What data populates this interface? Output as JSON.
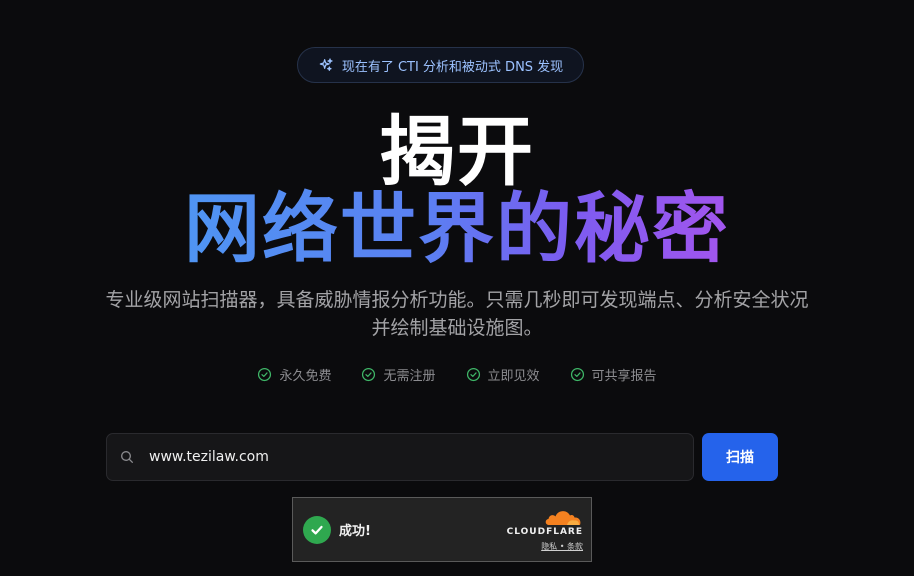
{
  "announcement": {
    "text": "现在有了 CTI 分析和被动式 DNS 发现",
    "icon": "sparkles-icon"
  },
  "headline": {
    "line1": "揭开",
    "line2": "网络世界的秘密"
  },
  "description": "专业级网站扫描器，具备威胁情报分析功能。只需几秒即可发现端点、分析安全状况并绘制基础设施图。",
  "features": [
    {
      "label": "永久免费",
      "icon": "check-circle-icon"
    },
    {
      "label": "无需注册",
      "icon": "check-circle-icon"
    },
    {
      "label": "立即见效",
      "icon": "check-circle-icon"
    },
    {
      "label": "可共享报告",
      "icon": "check-circle-icon"
    }
  ],
  "search": {
    "value": "www.tezilaw.com",
    "icon": "search-icon"
  },
  "scan_button": {
    "label": "扫描"
  },
  "turnstile": {
    "status": "成功!",
    "brand": "CLOUDFLARE",
    "links": "隐私 • 条款"
  },
  "colors": {
    "accent": "#2563eb",
    "success": "#2fa84f",
    "gradient_start": "#4f95f3",
    "gradient_end": "#a355ee"
  }
}
